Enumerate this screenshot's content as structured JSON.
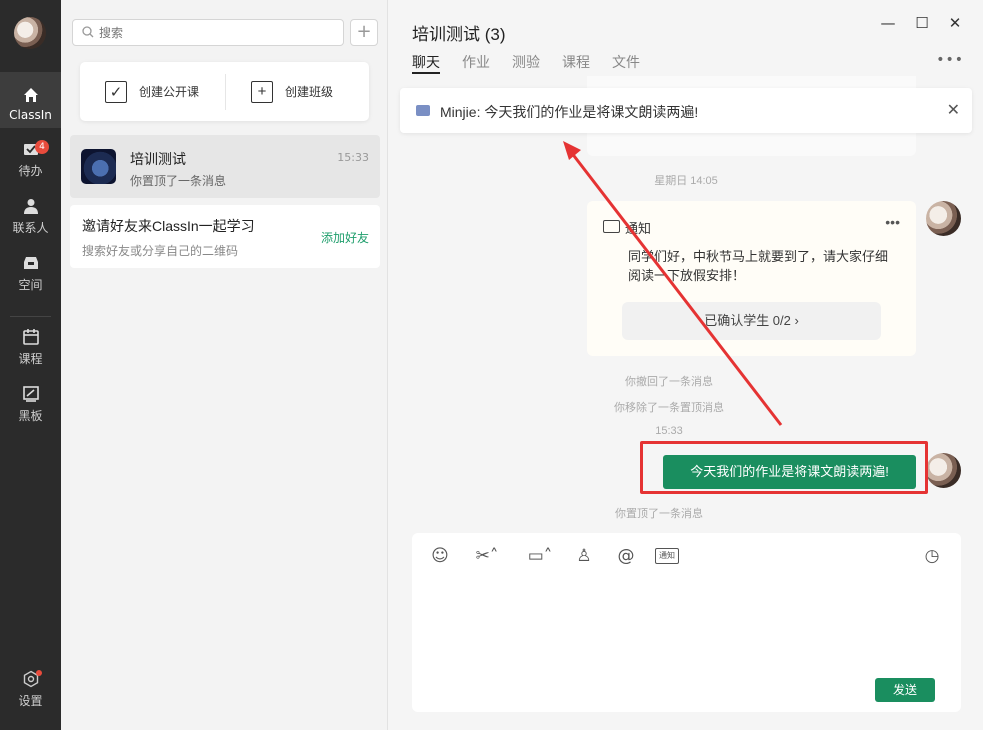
{
  "sidebar": {
    "nav": [
      {
        "label": "ClassIn",
        "icon": "home-icon"
      },
      {
        "label": "待办",
        "icon": "inbox-icon",
        "badge": "4"
      },
      {
        "label": "联系人",
        "icon": "person-icon"
      },
      {
        "label": "空间",
        "icon": "box-icon"
      },
      {
        "label": "课程",
        "icon": "calendar-icon"
      },
      {
        "label": "黑板",
        "icon": "blackboard-icon"
      },
      {
        "label": "设置",
        "icon": "gear-icon"
      }
    ]
  },
  "list": {
    "search_placeholder": "搜索",
    "create_public": "创建公开课",
    "create_class": "创建班级",
    "chat": {
      "name": "培训测试",
      "sub": "你置顶了一条消息",
      "time": "15:33"
    },
    "invite": {
      "title": "邀请好友来ClassIn一起学习",
      "sub": "搜索好友或分享自己的二维码",
      "link": "添加好友"
    }
  },
  "chat": {
    "title": "培训测试 (3)",
    "tabs": [
      "聊天",
      "作业",
      "测验",
      "课程",
      "文件"
    ],
    "pinned": "Minjie: 今天我们的作业是将课文朗读两遍!",
    "ts1": "星期日 14:05",
    "notice": {
      "title": "通知",
      "body": "同学们好，中秋节马上就要到了，请大家仔细阅读一下放假安排！",
      "confirm": "已确认学生 0/2 ›"
    },
    "sys1": "你撤回了一条消息",
    "sys2": "你移除了一条置顶消息",
    "ts2": "15:33",
    "my_message": "今天我们的作业是将课文朗读两遍!",
    "sys3": "你置顶了一条消息",
    "send": "发送",
    "notice_tool": "通知"
  },
  "colors": {
    "accent": "#1a8e5f",
    "highlight": "#e53333",
    "sidebar": "#2b2b2b"
  }
}
